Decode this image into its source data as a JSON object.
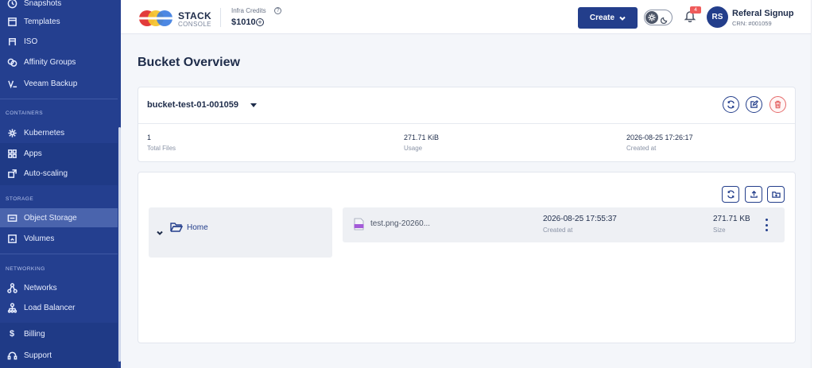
{
  "sidebar": {
    "items_top": [
      {
        "label": "Snapshots",
        "icon": "clock-icon"
      },
      {
        "label": "Templates",
        "icon": "template-icon"
      },
      {
        "label": "ISO",
        "icon": "iso-icon"
      },
      {
        "label": "Affinity Groups",
        "icon": "affinity-icon"
      },
      {
        "label": "Veeam Backup",
        "icon": "veeam-icon"
      }
    ],
    "sections": {
      "containers": "CONTAINERS",
      "storage": "STORAGE",
      "networking": "NETWORKING"
    },
    "containers_items": [
      {
        "label": "Kubernetes",
        "icon": "kubernetes-icon"
      },
      {
        "label": "Apps",
        "icon": "apps-icon"
      },
      {
        "label": "Auto-scaling",
        "icon": "autoscaling-icon"
      }
    ],
    "storage_items": [
      {
        "label": "Object Storage",
        "icon": "object-storage-icon",
        "active": true
      },
      {
        "label": "Volumes",
        "icon": "volumes-icon"
      }
    ],
    "networking_items": [
      {
        "label": "Networks",
        "icon": "networks-icon"
      },
      {
        "label": "Load Balancer",
        "icon": "load-balancer-icon"
      }
    ],
    "bottom_items": [
      {
        "label": "Billing",
        "icon": "dollar-icon"
      },
      {
        "label": "Support",
        "icon": "support-icon"
      }
    ]
  },
  "header": {
    "logo_title": "STACK",
    "logo_subtitle": "CONSOLE",
    "credits_label": "Infra Credits",
    "credits_value": "$1010",
    "create_label": "Create",
    "notification_count": "4",
    "avatar_initials": "RS",
    "user_name": "Referal Signup",
    "user_crn": "CRN: #001059"
  },
  "main": {
    "page_title": "Bucket Overview",
    "bucket": {
      "name": "bucket-test-01-001059",
      "stats": [
        {
          "value": "1",
          "label": "Total Files"
        },
        {
          "value": "271.71 KiB",
          "label": "Usage"
        },
        {
          "value": "2026-08-25 17:26:17",
          "label": "Created at"
        }
      ]
    },
    "tree": {
      "root_label": "Home"
    },
    "files": [
      {
        "name": "test.png-20260...",
        "created": "2026-08-25 17:55:37",
        "created_label": "Created at",
        "size": "271.71 KB",
        "size_label": "Size"
      }
    ]
  },
  "colors": {
    "sidebar_bg": "#243f8f",
    "primary": "#233e8b",
    "danger": "#e56a6a",
    "badge": "#ef5b5b"
  }
}
